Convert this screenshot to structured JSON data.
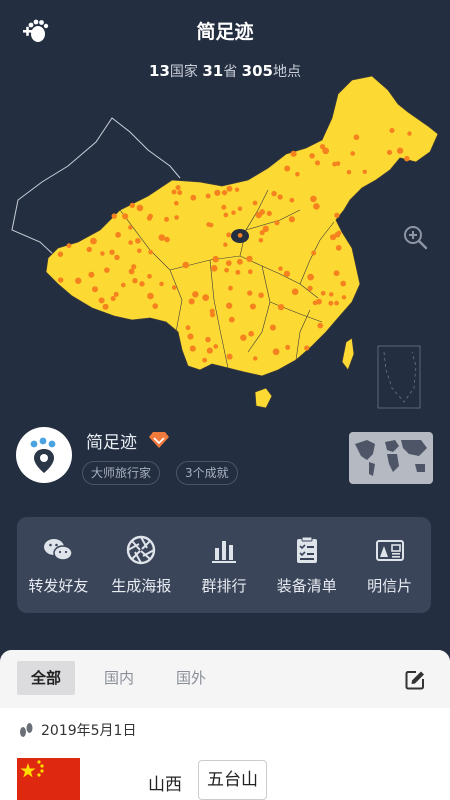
{
  "header": {
    "title": "简足迹",
    "logo_icon": "footprint-plus-icon"
  },
  "stats": {
    "countries": "13",
    "countries_label": "国家",
    "provinces": "31",
    "provinces_label": "省",
    "places": "305",
    "places_label": "地点"
  },
  "map": {
    "visited_color": "#fcd933",
    "marker_color": "#f5821f",
    "zoom_icon": "zoom-in-icon"
  },
  "profile": {
    "name": "简足迹",
    "badge_icon": "diamond-vip-icon",
    "tags": [
      "大师旅行家",
      "3个成就"
    ]
  },
  "actions": [
    {
      "label": "转发好友",
      "icon": "wechat-icon"
    },
    {
      "label": "生成海报",
      "icon": "aperture-icon"
    },
    {
      "label": "群排行",
      "icon": "bar-chart-icon"
    },
    {
      "label": "装备清单",
      "icon": "checklist-icon"
    },
    {
      "label": "明信片",
      "icon": "postcard-icon"
    }
  ],
  "tabs": [
    {
      "label": "全部",
      "active": true
    },
    {
      "label": "国内",
      "active": false
    },
    {
      "label": "国外",
      "active": false
    }
  ],
  "trip": {
    "date": "2019年5月1日",
    "region": "山西",
    "place": "五台山",
    "flag_icon": "china-flag-icon"
  }
}
